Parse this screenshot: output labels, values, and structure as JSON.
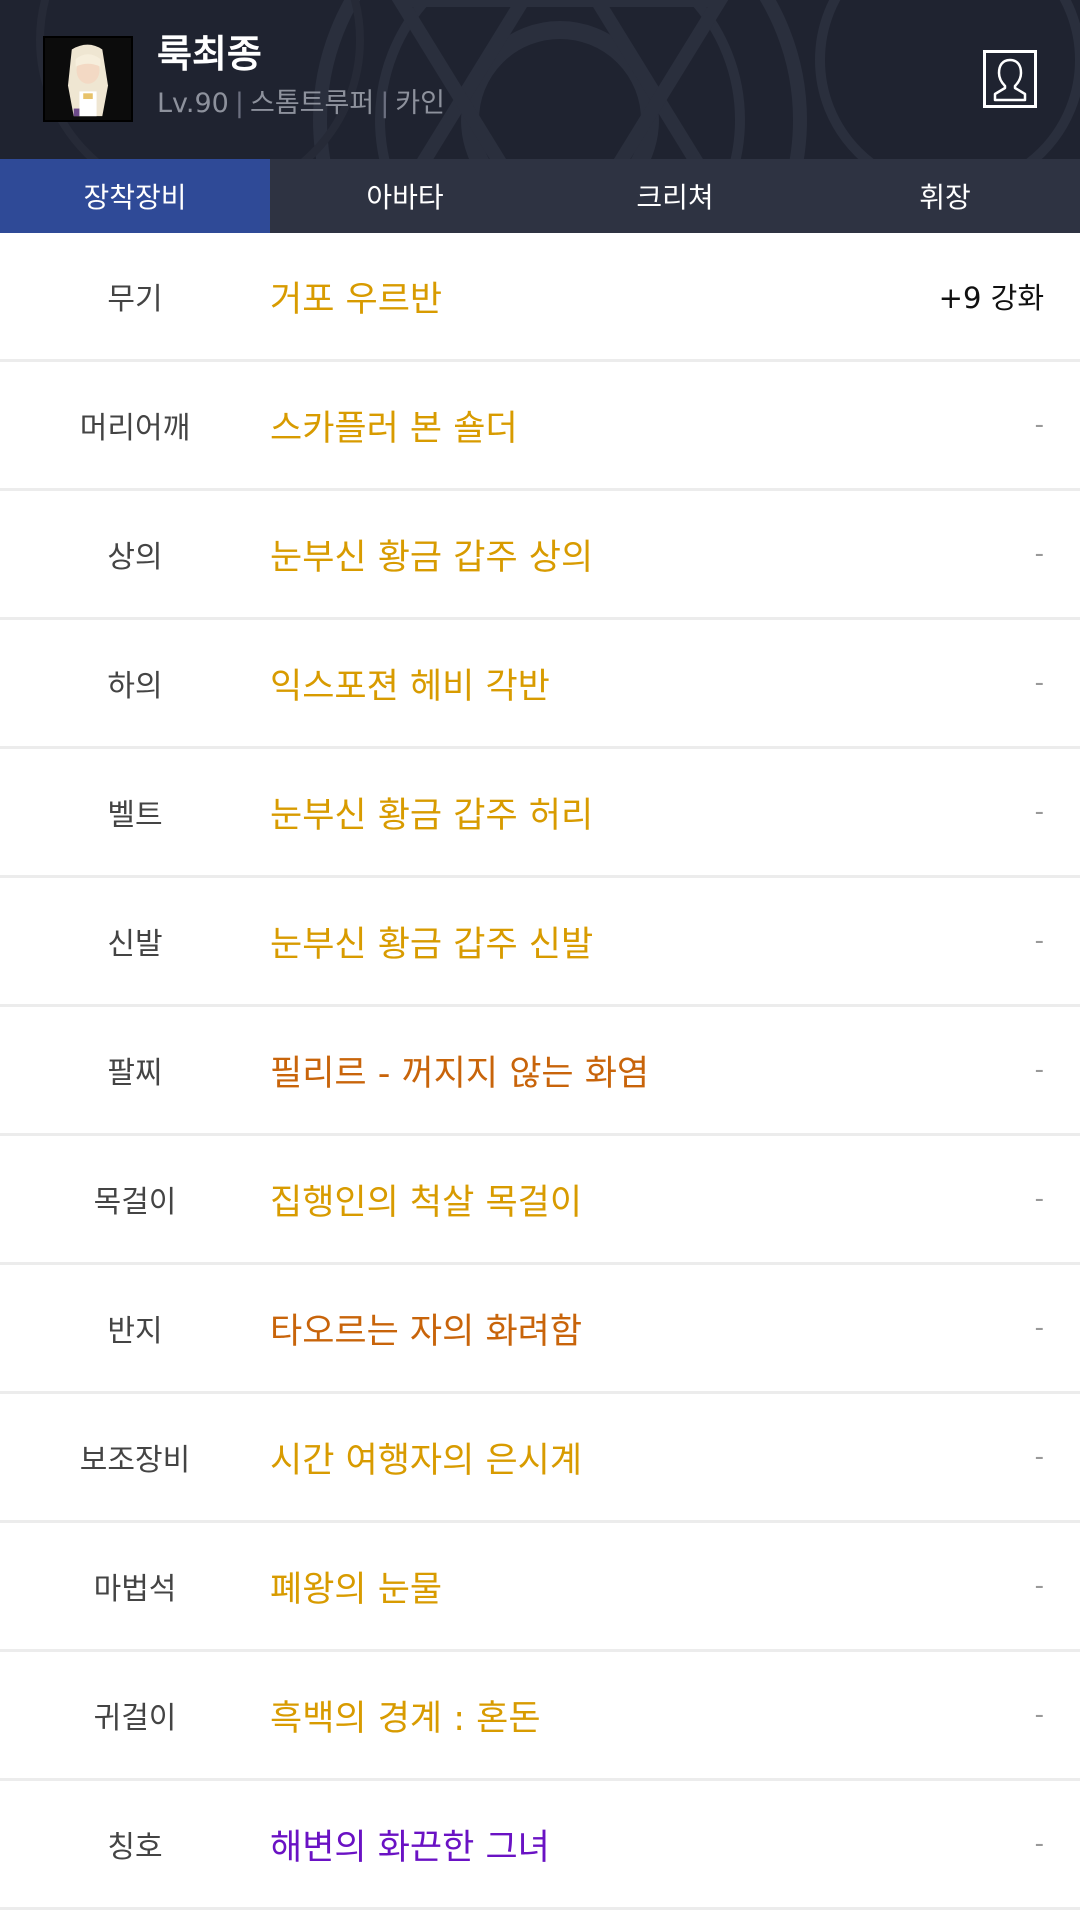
{
  "header": {
    "name": "룩최종",
    "level": "Lv.90",
    "job": "스톰트루퍼",
    "server": "카인",
    "separator": "|"
  },
  "colors": {
    "unique": "#d89b00",
    "legendary": "#c8640a",
    "epic_title": "#6a12c4",
    "tab_active": "#2f4a97"
  },
  "tabs": [
    {
      "label": "장착장비",
      "active": true
    },
    {
      "label": "아바타",
      "active": false
    },
    {
      "label": "크리쳐",
      "active": false
    },
    {
      "label": "휘장",
      "active": false
    }
  ],
  "equipment": [
    {
      "slot": "무기",
      "item": "거포 우르반",
      "enhance": "+9 강화",
      "color": "#d89b00"
    },
    {
      "slot": "머리어깨",
      "item": "스카플러 본 숄더",
      "enhance": "-",
      "color": "#d89b00"
    },
    {
      "slot": "상의",
      "item": "눈부신 황금 갑주 상의",
      "enhance": "-",
      "color": "#d89b00"
    },
    {
      "slot": "하의",
      "item": "익스포젼 헤비 각반",
      "enhance": "-",
      "color": "#d89b00"
    },
    {
      "slot": "벨트",
      "item": "눈부신 황금 갑주 허리",
      "enhance": "-",
      "color": "#d89b00"
    },
    {
      "slot": "신발",
      "item": "눈부신 황금 갑주 신발",
      "enhance": "-",
      "color": "#d89b00"
    },
    {
      "slot": "팔찌",
      "item": "필리르 - 꺼지지 않는 화염",
      "enhance": "-",
      "color": "#c8640a"
    },
    {
      "slot": "목걸이",
      "item": "집행인의 척살 목걸이",
      "enhance": "-",
      "color": "#d89b00"
    },
    {
      "slot": "반지",
      "item": "타오르는 자의 화려함",
      "enhance": "-",
      "color": "#c8640a"
    },
    {
      "slot": "보조장비",
      "item": "시간 여행자의 은시계",
      "enhance": "-",
      "color": "#d89b00"
    },
    {
      "slot": "마법석",
      "item": "폐왕의 눈물",
      "enhance": "-",
      "color": "#d89b00"
    },
    {
      "slot": "귀걸이",
      "item": "흑백의 경계 : 혼돈",
      "enhance": "-",
      "color": "#d89b00"
    },
    {
      "slot": "칭호",
      "item": "해변의 화끈한 그녀",
      "enhance": "-",
      "color": "#6a12c4"
    }
  ]
}
